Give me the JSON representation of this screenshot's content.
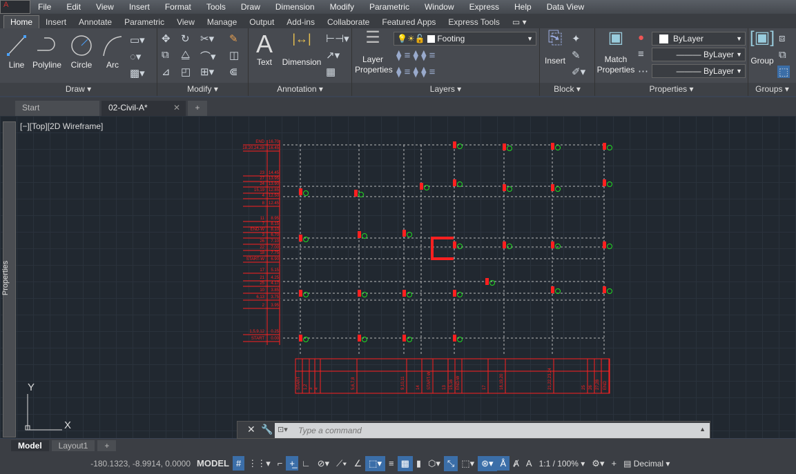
{
  "menu": {
    "items": [
      "File",
      "Edit",
      "View",
      "Insert",
      "Format",
      "Tools",
      "Draw",
      "Dimension",
      "Modify",
      "Parametric",
      "Window",
      "Express",
      "Help",
      "Data View"
    ]
  },
  "ribbon_tabs": [
    "Home",
    "Insert",
    "Annotate",
    "Parametric",
    "View",
    "Manage",
    "Output",
    "Add-ins",
    "Collaborate",
    "Featured Apps",
    "Express Tools"
  ],
  "panels": {
    "draw": {
      "title": "Draw",
      "line": "Line",
      "polyline": "Polyline",
      "circle": "Circle",
      "arc": "Arc"
    },
    "modify": {
      "title": "Modify"
    },
    "annotation": {
      "title": "Annotation",
      "text": "Text",
      "dimension": "Dimension"
    },
    "layers": {
      "title": "Layers",
      "layer_properties": "Layer Properties",
      "current_layer": "Footing"
    },
    "block": {
      "title": "Block",
      "insert": "Insert"
    },
    "properties": {
      "title": "Properties",
      "match": "Match Properties",
      "color": "ByLayer",
      "linetype": "ByLayer",
      "lineweight": "ByLayer"
    },
    "groups": {
      "title": "Groups",
      "group": "Group"
    }
  },
  "doc_tabs": [
    "Start",
    "02-Civil-A*"
  ],
  "viewport_label": "[−][Top][2D Wireframe]",
  "properties_palette": "Properties",
  "ucs": {
    "x": "X",
    "y": "Y"
  },
  "drawing": {
    "left_labels": [
      [
        "END",
        "16.70"
      ],
      [
        "18,20,24,28",
        "16.45"
      ],
      [
        "23",
        "14.45"
      ],
      [
        "27",
        "13.95"
      ],
      [
        "24",
        "13.90"
      ],
      [
        "15,19",
        "12.85"
      ],
      [
        "4",
        "12.50"
      ],
      [
        "8",
        "12.45"
      ],
      [
        "11",
        "8.95"
      ],
      [
        "7",
        "8.15"
      ],
      [
        "END-W",
        "8.10"
      ],
      [
        "3",
        "6.70"
      ],
      [
        "26",
        "7.10"
      ],
      [
        "22",
        "7.00"
      ],
      [
        "18",
        "7.75"
      ],
      [
        "START-W",
        "6.90"
      ],
      [
        "17",
        "5.15"
      ],
      [
        "21",
        "4.25"
      ],
      [
        "25",
        "4.17"
      ],
      [
        "10",
        "3.85"
      ],
      [
        "6,13",
        "3.75"
      ],
      [
        "2",
        "3.95"
      ],
      [
        "1,5,9,12",
        "0.25"
      ],
      [
        "START",
        "0.00"
      ]
    ],
    "bottom_labels": [
      "START",
      "1,2",
      "3",
      "4",
      "5,6,7,8",
      "9,10,11",
      "14",
      "START-W",
      "13",
      "15,16",
      "END-W",
      "17",
      "18,19,20",
      "21,22,23,24",
      "25",
      "26",
      "27,28",
      "END"
    ],
    "line_color": "#ff2020",
    "marker_color": "#22dd22"
  },
  "command": {
    "placeholder": "Type a command"
  },
  "layout_tabs": [
    "Model",
    "Layout1"
  ],
  "status": {
    "coords": "-180.1323, -8.9914, 0.0000",
    "model": "MODEL",
    "scale": "1:1 / 100%",
    "units": "Decimal"
  }
}
